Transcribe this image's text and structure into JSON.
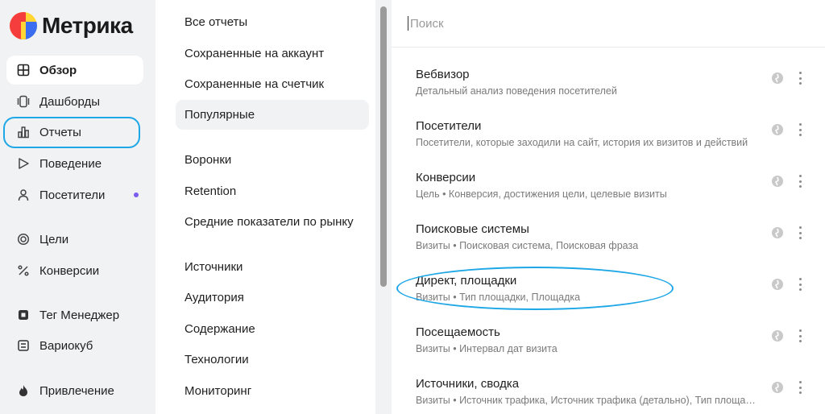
{
  "app": {
    "title": "Метрика"
  },
  "sidebar": {
    "items": [
      {
        "label": "Обзор",
        "icon": "overview-grid-icon",
        "active": true
      },
      {
        "label": "Дашборды",
        "icon": "dashboards-icon"
      },
      {
        "label": "Отчеты",
        "icon": "reports-bar-chart-icon",
        "highlighted": true
      },
      {
        "label": "Поведение",
        "icon": "play-triangle-icon"
      },
      {
        "label": "Посетители",
        "icon": "person-icon",
        "badge_dot": true
      },
      {
        "label": "Цели",
        "icon": "target-icon"
      },
      {
        "label": "Конверсии",
        "icon": "percent-icon"
      },
      {
        "label": "Тег Менеджер",
        "icon": "tag-manager-icon"
      },
      {
        "label": "Вариокуб",
        "icon": "variocube-icon"
      },
      {
        "label": "Привлечение",
        "icon": "flame-icon"
      }
    ],
    "accent_dot_color": "#7b5cf0"
  },
  "reports_nav": {
    "items": [
      {
        "label": "Все отчеты"
      },
      {
        "label": "Сохраненные на аккаунт"
      },
      {
        "label": "Сохраненные на счетчик"
      },
      {
        "label": "Популярные",
        "selected": true
      },
      {
        "label": "Воронки"
      },
      {
        "label": "Retention"
      },
      {
        "label": "Средние показатели по рынку"
      },
      {
        "label": "Источники"
      },
      {
        "label": "Аудитория"
      },
      {
        "label": "Содержание"
      },
      {
        "label": "Технологии"
      },
      {
        "label": "Мониторинг"
      }
    ]
  },
  "search": {
    "placeholder": "Поиск",
    "value": ""
  },
  "reports": [
    {
      "title": "Вебвизор",
      "description": "Детальный анализ поведения посетителей"
    },
    {
      "title": "Посетители",
      "description": "Посетители, которые заходили на сайт, история их визитов и действий"
    },
    {
      "title": "Конверсии",
      "description": "Цель • Конверсия, достижения цели, целевые визиты"
    },
    {
      "title": "Поисковые системы",
      "description": "Визиты • Поисковая система, Поисковая фраза"
    },
    {
      "title": "Директ, площадки",
      "description": "Визиты • Тип площадки, Площадка",
      "highlighted": true
    },
    {
      "title": "Посещаемость",
      "description": "Визиты • Интервал дат визита"
    },
    {
      "title": "Источники, сводка",
      "description": "Визиты • Источник трафика, Источник трафика (детально), Тип площадки"
    }
  ],
  "colors": {
    "highlight_annotation": "#1ea7e6",
    "sidebar_bg": "#f1f2f4",
    "logo_red": "#f63d3d",
    "logo_yellow": "#ffd633",
    "logo_blue": "#3a6df0"
  }
}
